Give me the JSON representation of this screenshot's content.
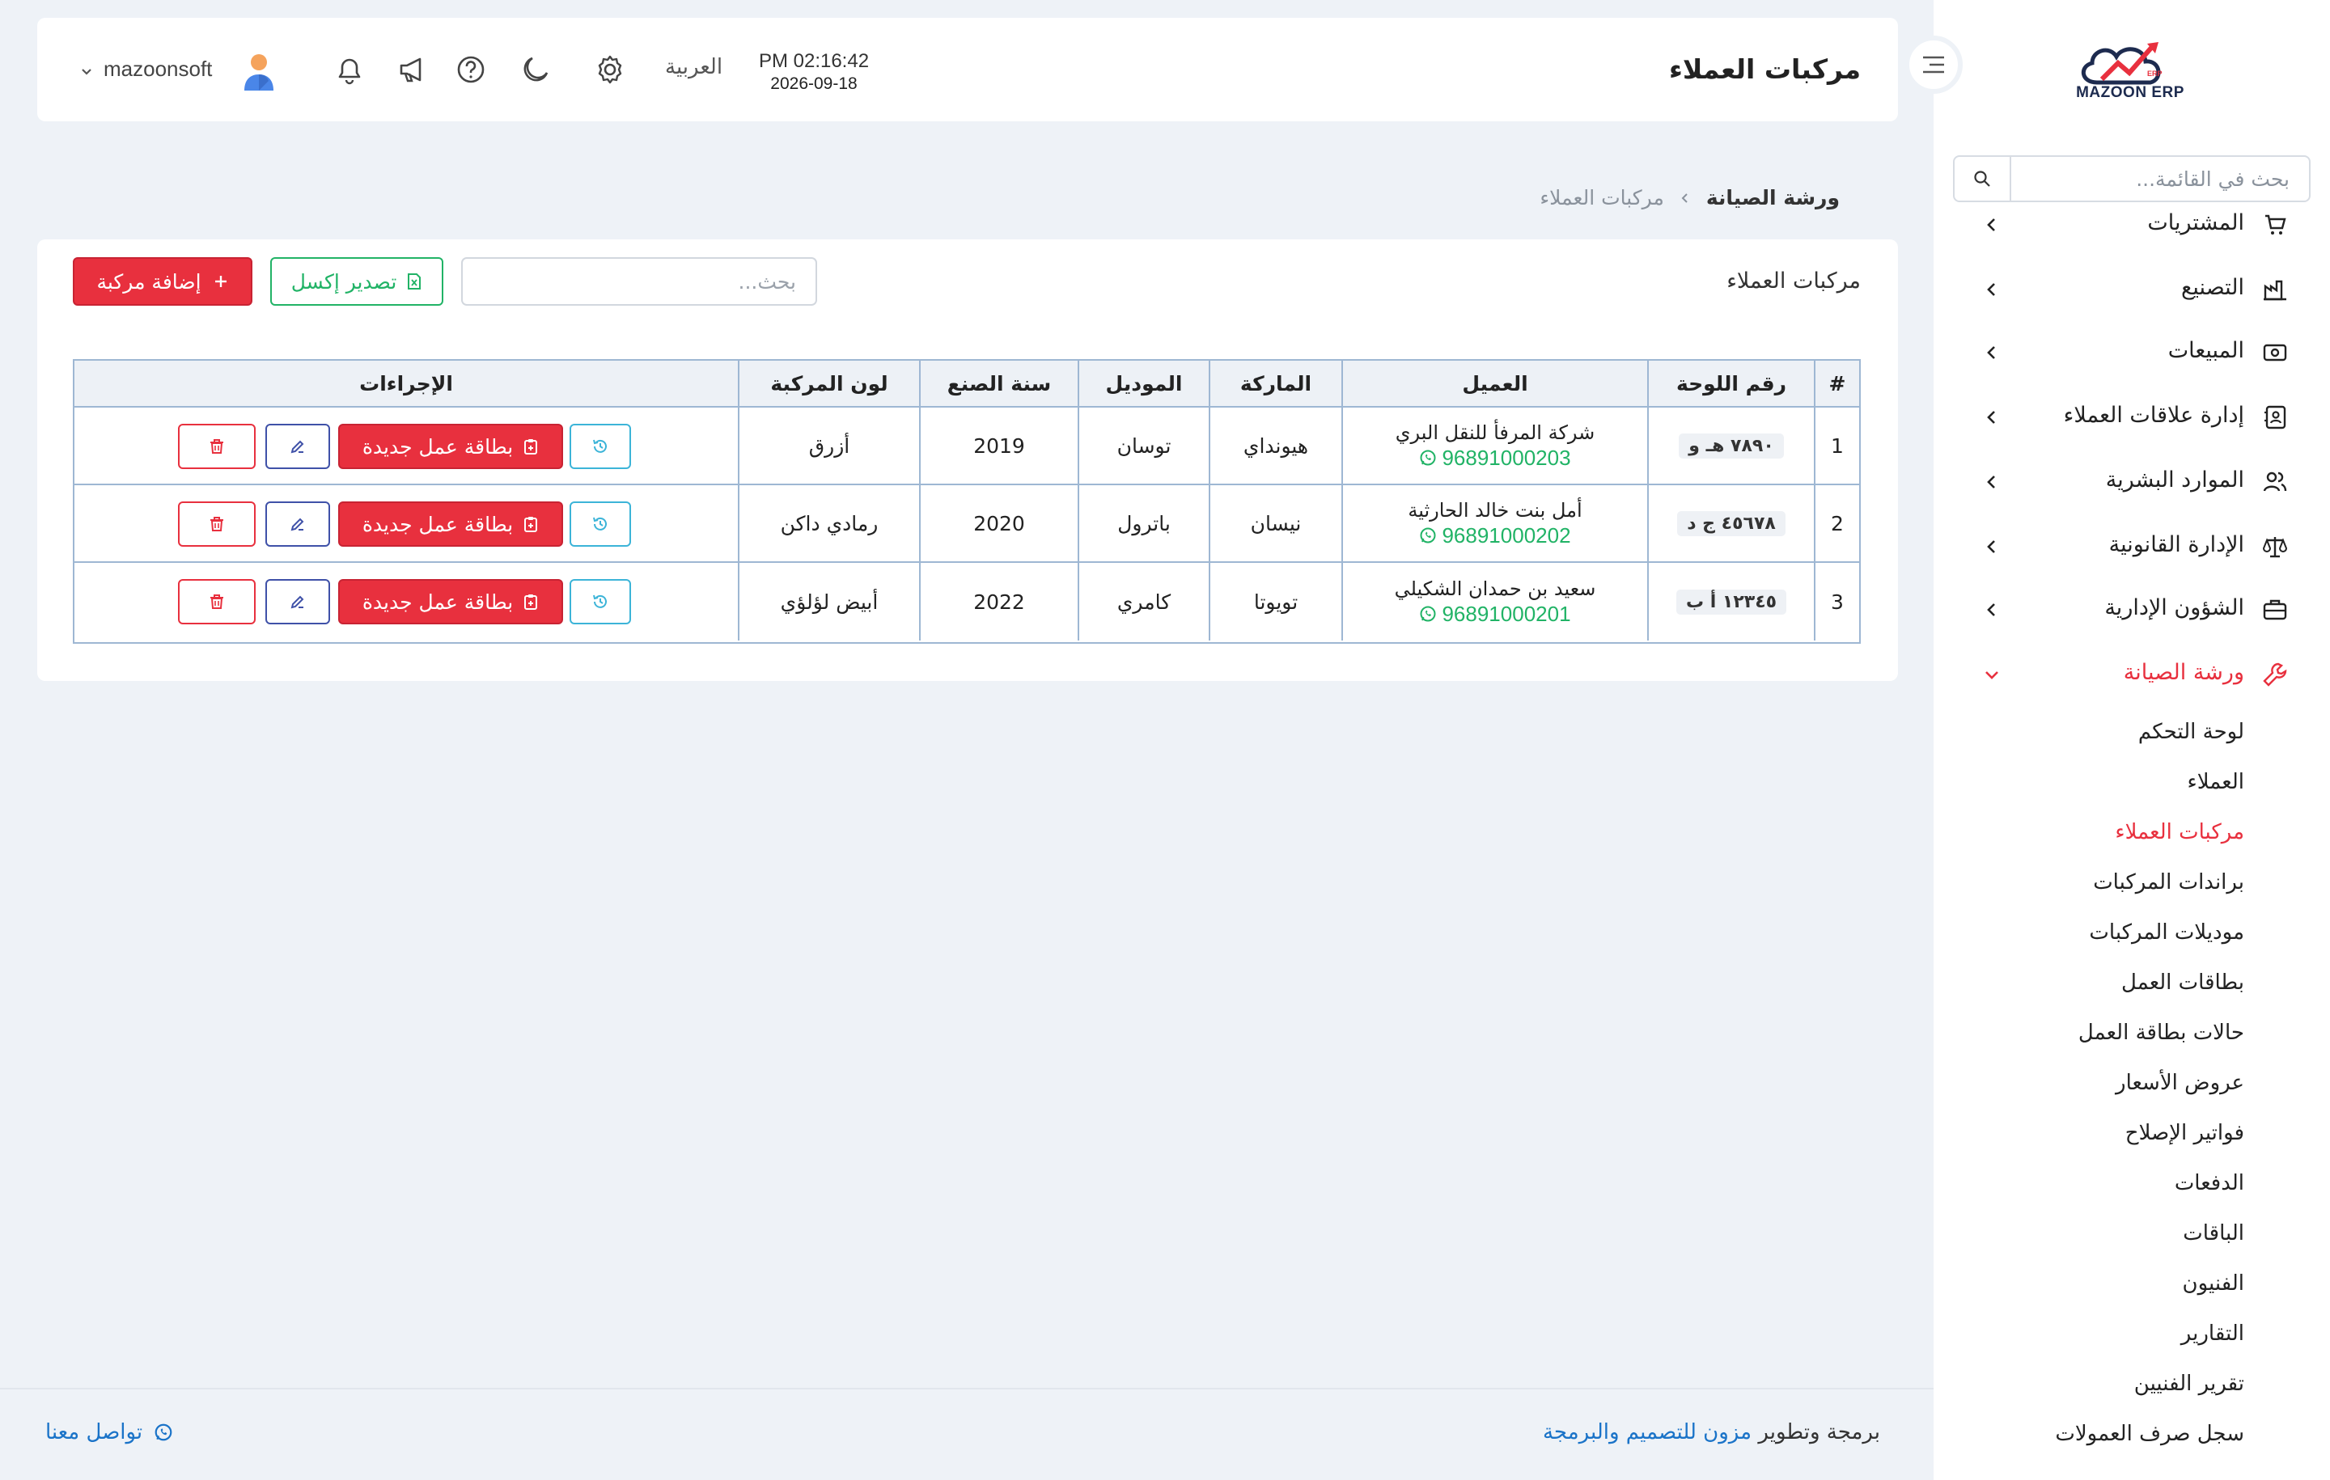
{
  "app": {
    "logo_text": "MAZOON ERP"
  },
  "colors": {
    "accent_red": "#e8303e",
    "green": "#21b366",
    "link_blue": "#1a73c8",
    "background": "#eef2f7"
  },
  "sidebar": {
    "search_placeholder": "بحث في القائمة...",
    "items": [
      {
        "label": "المشتريات",
        "icon": "cart-icon"
      },
      {
        "label": "التصنيع",
        "icon": "factory-icon"
      },
      {
        "label": "المبيعات",
        "icon": "cash-icon"
      },
      {
        "label": "إدارة علاقات العملاء",
        "icon": "contacts-icon"
      },
      {
        "label": "الموارد البشرية",
        "icon": "users-icon"
      },
      {
        "label": "الإدارة القانونية",
        "icon": "scale-icon"
      },
      {
        "label": "الشؤون الإدارية",
        "icon": "briefcase-icon"
      },
      {
        "label": "ورشة الصيانة",
        "icon": "wrench-icon",
        "active": true
      }
    ],
    "sub_items": [
      "لوحة التحكم",
      "العملاء",
      "مركبات العملاء",
      "براندات المركبات",
      "موديلات المركبات",
      "بطاقات العمل",
      "حالات بطاقة العمل",
      "عروض الأسعار",
      "فواتير الإصلاح",
      "الدفعات",
      "الباقات",
      "الفنيون",
      "التقارير",
      "تقرير الفنيين",
      "سجل صرف العمولات"
    ],
    "active_sub_index": 2
  },
  "header": {
    "title": "مركبات العملاء",
    "time": "PM 02:16:42",
    "date": "2026-09-18",
    "language": "العربية",
    "username": "mazoonsoft"
  },
  "breadcrumb": {
    "parent": "ورشة الصيانة",
    "current": "مركبات العملاء"
  },
  "card": {
    "title": "مركبات العملاء",
    "search_placeholder": "بحث...",
    "export_label": "تصدير إكسل",
    "add_label": "إضافة مركبة",
    "columns": [
      "#",
      "رقم اللوحة",
      "العميل",
      "الماركة",
      "الموديل",
      "سنة الصنع",
      "لون المركبة",
      "الإجراءات"
    ],
    "new_job_label": "بطاقة عمل جديدة",
    "rows": [
      {
        "num": "1",
        "plate": "٧٨٩٠ هـ و",
        "customer": "شركة المرفأ للنقل البري",
        "phone": "96891000203",
        "brand": "هيونداي",
        "model": "توسان",
        "year": "2019",
        "color": "أزرق"
      },
      {
        "num": "2",
        "plate": "٤٥٦٧٨ ج د",
        "customer": "أمل بنت خالد الحارثية",
        "phone": "96891000202",
        "brand": "نيسان",
        "model": "باترول",
        "year": "2020",
        "color": "رمادي داكن"
      },
      {
        "num": "3",
        "plate": "١٢٣٤٥ أ ب",
        "customer": "سعيد بن حمدان الشكيلي",
        "phone": "96891000201",
        "brand": "تويوتا",
        "model": "كامري",
        "year": "2022",
        "color": "أبيض لؤلؤي"
      }
    ]
  },
  "footer": {
    "prefix": "برمجة وتطوير",
    "brand": "مزون للتصميم والبرمجة",
    "contact": "تواصل معنا"
  }
}
